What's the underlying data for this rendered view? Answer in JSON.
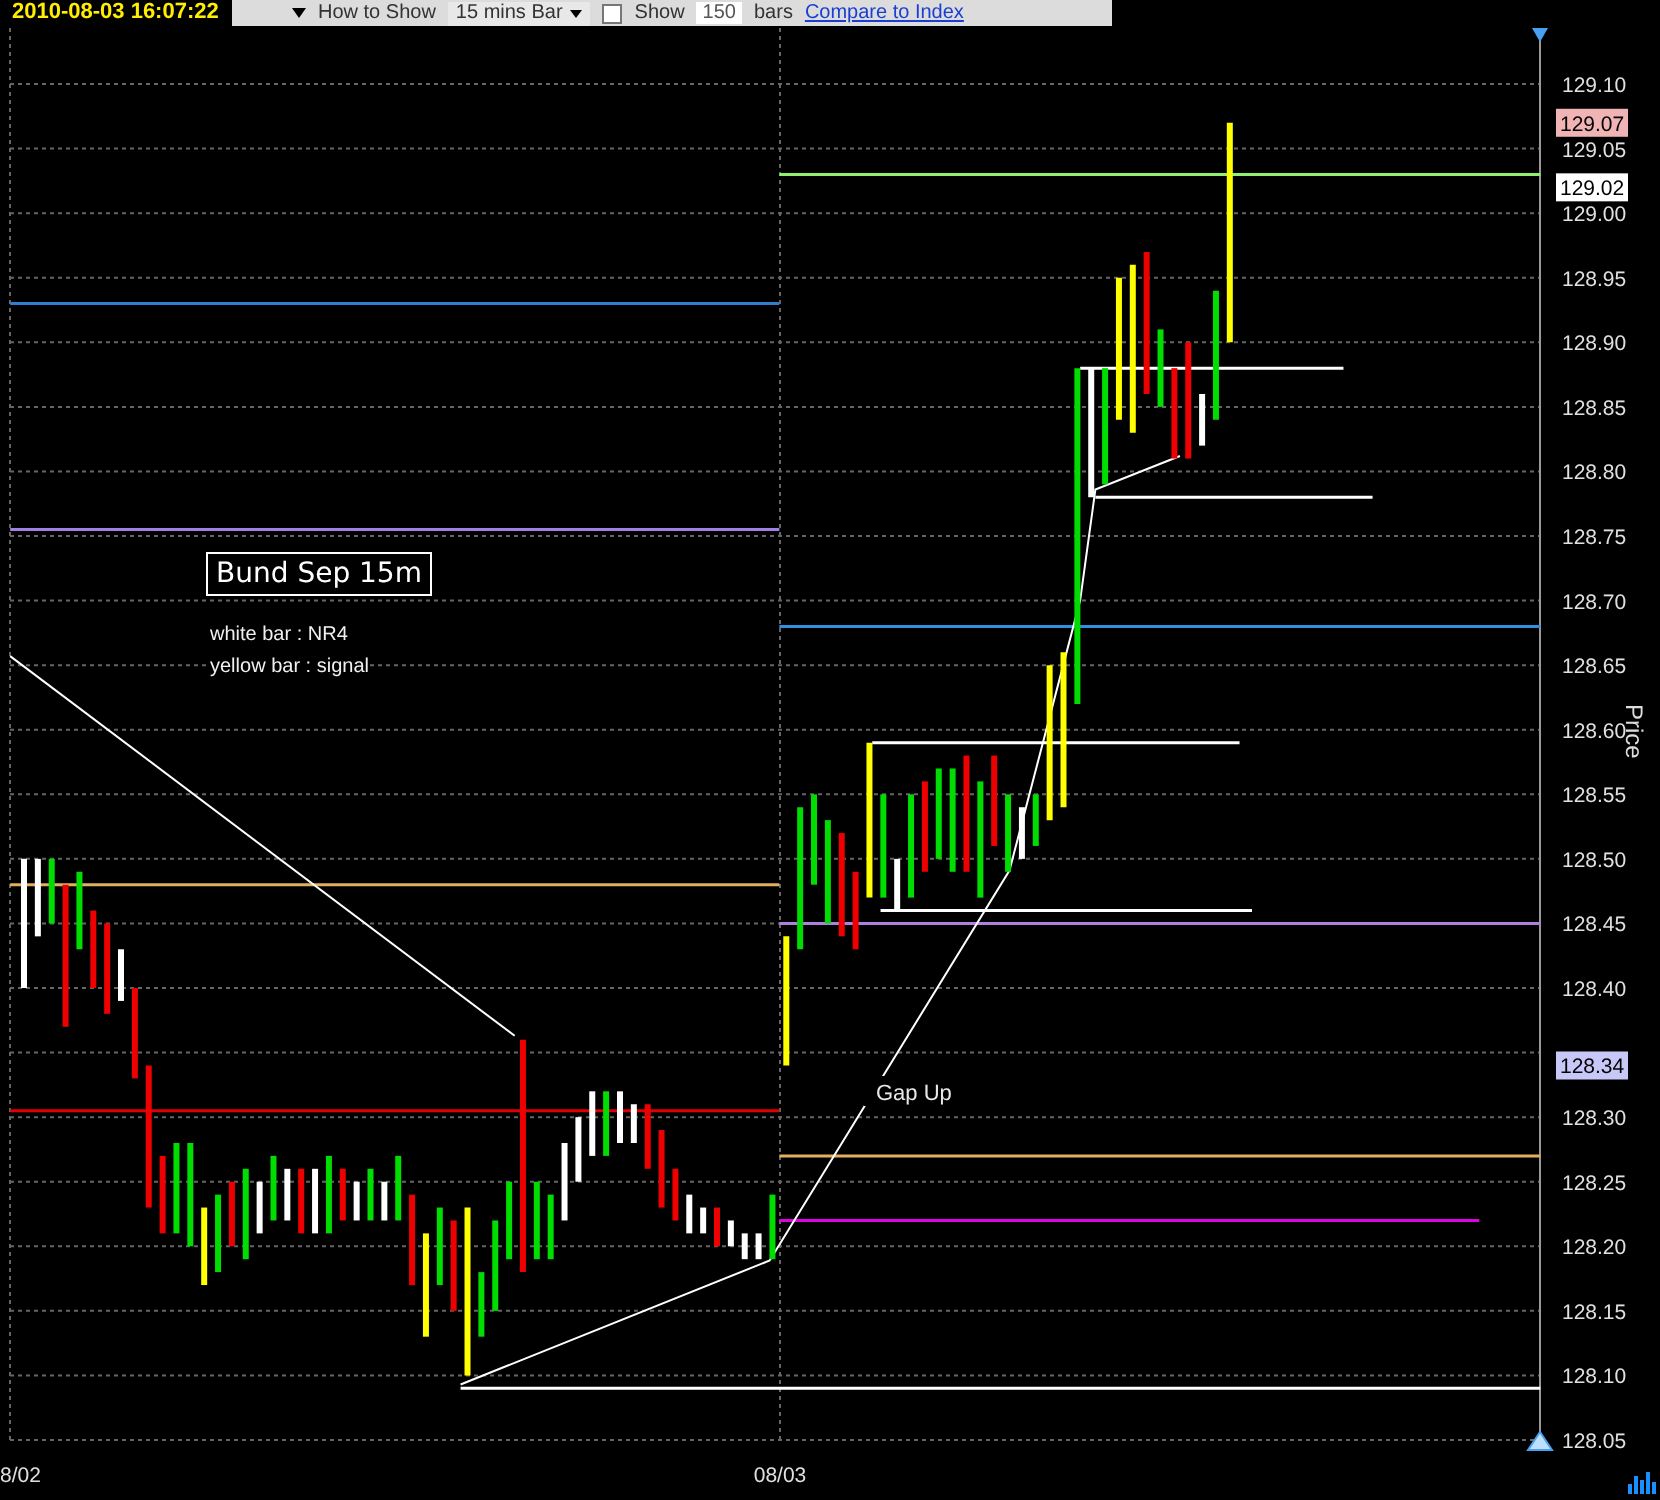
{
  "timestamp": "2010-08-03 16:07:22",
  "toolbar": {
    "how_to_show_label": "How to Show",
    "interval": "15 mins Bar",
    "show_checkbox": {
      "label": "Show",
      "checked": false
    },
    "bar_count": "150",
    "bars_label": "bars",
    "compare_link": "Compare to Index"
  },
  "chart": {
    "title": "Bund Sep 15m",
    "legend": [
      "white bar : NR4",
      "yellow bar : signal"
    ],
    "note": "Gap Up",
    "price_axis": {
      "title": "Price",
      "labels": [
        "129.10",
        "129.05",
        "129.00",
        "128.95",
        "128.90",
        "128.85",
        "128.80",
        "128.75",
        "128.70",
        "128.65",
        "128.60",
        "128.55",
        "128.50",
        "128.45",
        "128.40",
        "128.30",
        "128.25",
        "128.20",
        "128.15",
        "128.10",
        "128.05"
      ]
    },
    "price_tags": [
      {
        "text": "129.07",
        "color": "#f0b4b4"
      },
      {
        "text": "129.02",
        "color": "#ffffff"
      },
      {
        "text": "128.34",
        "color": "#c8c8f8"
      }
    ],
    "date_labels": [
      "8/02",
      "08/03"
    ]
  }
}
